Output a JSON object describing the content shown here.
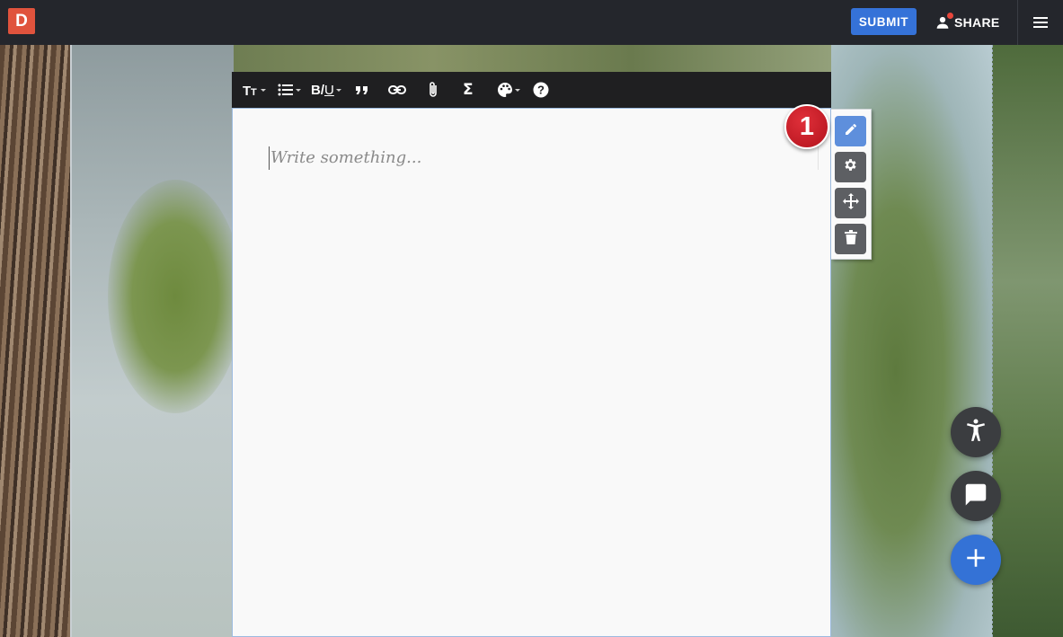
{
  "header": {
    "logo_text": "D",
    "submit_label": "SUBMIT",
    "share_label": "SHARE",
    "icons": [
      "user-icon",
      "hamburger-menu-icon"
    ],
    "colors": {
      "bar": "#24262c",
      "logo": "#e0533d",
      "submit": "#3572d8",
      "notification": "#e8463b"
    }
  },
  "toolbar": {
    "items": [
      "text-size-icon",
      "list-icon",
      "bold-underline-icon",
      "quote-icon",
      "link-icon",
      "attachment-icon",
      "sigma-icon",
      "palette-icon",
      "help-icon"
    ],
    "bold_underline_text": "B/U",
    "text_size_text": "Tт"
  },
  "editor": {
    "placeholder": "Write something..."
  },
  "block_tools": {
    "items": [
      "pencil-icon",
      "gear-icon",
      "move-icon",
      "trash-icon"
    ],
    "active": "pencil-icon",
    "colors": {
      "active": "#5e8fdc",
      "default": "#5d5f63"
    }
  },
  "callout": {
    "number": "1",
    "color": "#c4161f"
  },
  "fabs": {
    "items": [
      "accessibility-icon",
      "chat-icon",
      "plus-icon"
    ],
    "colors": {
      "dark": "#3b3d40",
      "blue": "#3472d6"
    }
  }
}
